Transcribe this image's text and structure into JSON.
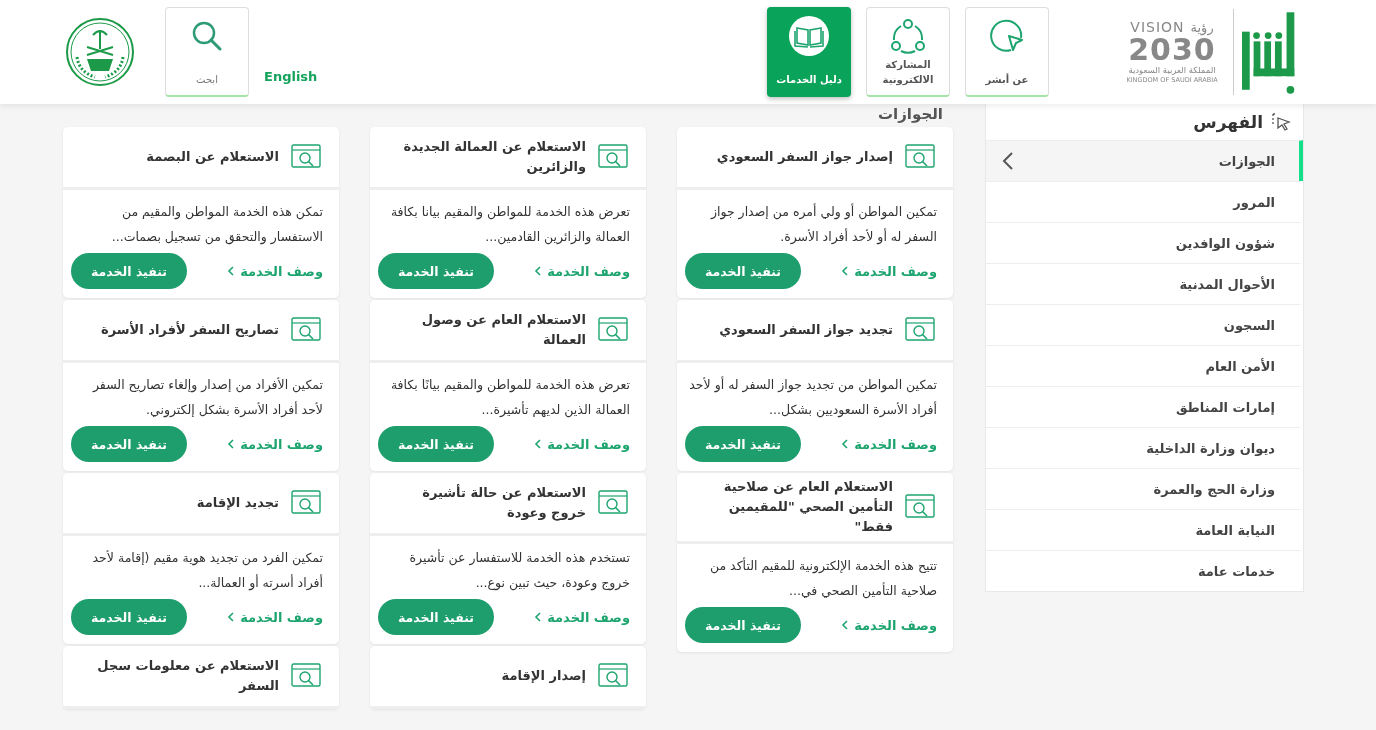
{
  "header": {
    "brand": {
      "vision": "VISION",
      "vision_ar": "رؤية",
      "year": "2030",
      "kingdom_ar": "المملكة العربية السعودية",
      "kingdom_en": "KINGDOM OF SAUDI ARABIA"
    },
    "nav": [
      {
        "label": "عن أبشر",
        "kind": "cursor",
        "selected": false
      },
      {
        "label": "المشاركة الالكترونية",
        "kind": "share",
        "selected": false
      },
      {
        "label": "دليل الخدمات",
        "kind": "book",
        "selected": true
      }
    ],
    "language_link": "English",
    "search": {
      "label": "ابحث"
    }
  },
  "sidebar": {
    "title": "الفهرس",
    "items": [
      {
        "label": "الجوازات",
        "selected": true
      },
      {
        "label": "المرور",
        "selected": false
      },
      {
        "label": "شؤون الوافدين",
        "selected": false
      },
      {
        "label": "الأحوال المدنية",
        "selected": false
      },
      {
        "label": "السجون",
        "selected": false
      },
      {
        "label": "الأمن العام",
        "selected": false
      },
      {
        "label": "إمارات المناطق",
        "selected": false
      },
      {
        "label": "ديوان وزارة الداخلية",
        "selected": false
      },
      {
        "label": "وزارة الحج والعمرة",
        "selected": false
      },
      {
        "label": "النيابة العامة",
        "selected": false
      },
      {
        "label": "خدمات عامة",
        "selected": false
      }
    ]
  },
  "section_title": "الجوازات",
  "columns": [
    {
      "cards": [
        {
          "title": "إصدار جواز السفر السعودي",
          "description": "تمكين المواطن أو ولي أمره من إصدار جواز السفر له أو لأحد أفراد الأسرة.",
          "link": "وصف الخدمة",
          "button": "تنفيذ الخدمة"
        },
        {
          "title": "تجديد جواز السفر السعودي",
          "description": "تمكين المواطن من تجديد جواز السفر له أو لأحد أفراد الأسرة السعوديين بشكل...",
          "link": "وصف الخدمة",
          "button": "تنفيذ الخدمة"
        },
        {
          "title": "الاستعلام العام عن صلاحية التأمين الصحي \"للمقيمين فقط\"",
          "description": "تتيح هذه الخدمة الإلكترونية للمقيم التأكد من صلاحية التأمين الصحي في...",
          "link": "وصف الخدمة",
          "button": "تنفيذ الخدمة"
        }
      ]
    },
    {
      "cards": [
        {
          "title": "الاستعلام عن العمالة الجديدة والزائرين",
          "description": "تعرض هذه الخدمة للمواطن والمقيم بيانا بكافة العمالة والزائرين القادمين...",
          "link": "وصف الخدمة",
          "button": "تنفيذ الخدمة"
        },
        {
          "title": "الاستعلام العام عن وصول العمالة",
          "description": "تعرض هذه الخدمة للمواطن والمقيم بيانًا بكافة العمالة الذين لديهم تأشيرة...",
          "link": "وصف الخدمة",
          "button": "تنفيذ الخدمة"
        },
        {
          "title": "الاستعلام عن حالة تأشيرة خروج وعودة",
          "description": "تستخدم هذه الخدمة للاستفسار عن تأشيرة خروج وعودة، حيث تبين نوع...",
          "link": "وصف الخدمة",
          "button": "تنفيذ الخدمة"
        },
        {
          "title": "إصدار الإقامة"
        }
      ]
    },
    {
      "cards": [
        {
          "title": "الاستعلام عن البصمة",
          "description": "تمكن هذه الخدمة المواطن والمقيم من الاستفسار والتحقق من تسجيل بصمات...",
          "link": "وصف الخدمة",
          "button": "تنفيذ الخدمة"
        },
        {
          "title": "تصاريح السفر لأفراد الأسرة",
          "description": "تمكين الأفراد من إصدار وإلغاء تصاريح السفر لأحد أفراد الأسرة بشكل إلكتروني.",
          "link": "وصف الخدمة",
          "button": "تنفيذ الخدمة"
        },
        {
          "title": "تجديد الإقامة",
          "description": "تمكين الفرد من تجديد هوية مقيم (إقامة لأحد أفراد أسرته أو العمالة...",
          "link": "وصف الخدمة",
          "button": "تنفيذ الخدمة"
        },
        {
          "title": "الاستعلام عن معلومات سجل السفر"
        }
      ]
    }
  ]
}
